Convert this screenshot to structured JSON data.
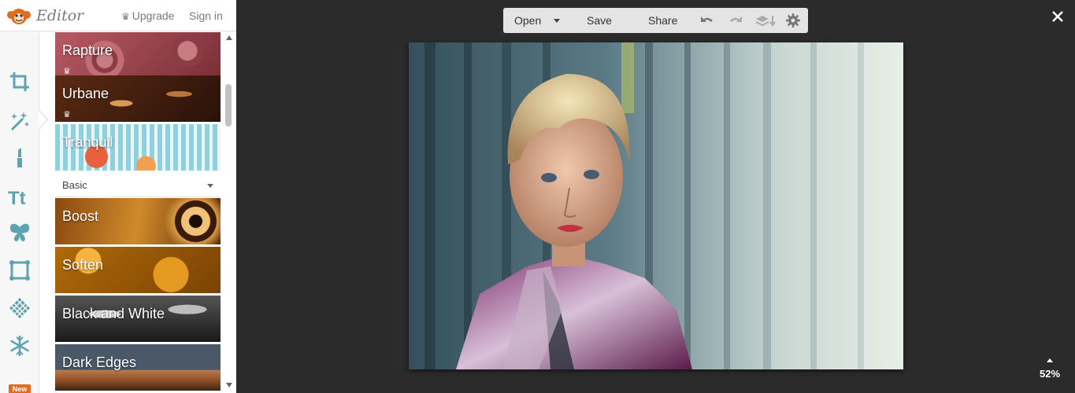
{
  "topbar": {
    "app_name": "Editor",
    "upgrade_label": "Upgrade",
    "signin_label": "Sign in"
  },
  "tools": [
    {
      "icon": "crop-icon"
    },
    {
      "icon": "magic-wand-icon",
      "active": true
    },
    {
      "icon": "lipstick-icon"
    },
    {
      "icon": "text-icon"
    },
    {
      "icon": "butterfly-icon"
    },
    {
      "icon": "frame-icon"
    },
    {
      "icon": "texture-icon"
    },
    {
      "icon": "snowflake-icon",
      "badge": "New"
    }
  ],
  "effects": {
    "premium": [
      {
        "label": "Rapture",
        "premium": true
      },
      {
        "label": "Urbane",
        "premium": true
      },
      {
        "label": "Tranquil",
        "premium": false
      }
    ],
    "category": "Basic",
    "basic": [
      {
        "label": "Boost"
      },
      {
        "label": "Soften"
      },
      {
        "label": "Black and White"
      },
      {
        "label": "Dark Edges"
      }
    ]
  },
  "canvas_toolbar": {
    "open_label": "Open",
    "save_label": "Save",
    "share_label": "Share"
  },
  "zoom": "52%",
  "colors": {
    "brand": "#e36b1f",
    "accent": "#5fa3b0",
    "workspace": "#2b2b2b"
  }
}
